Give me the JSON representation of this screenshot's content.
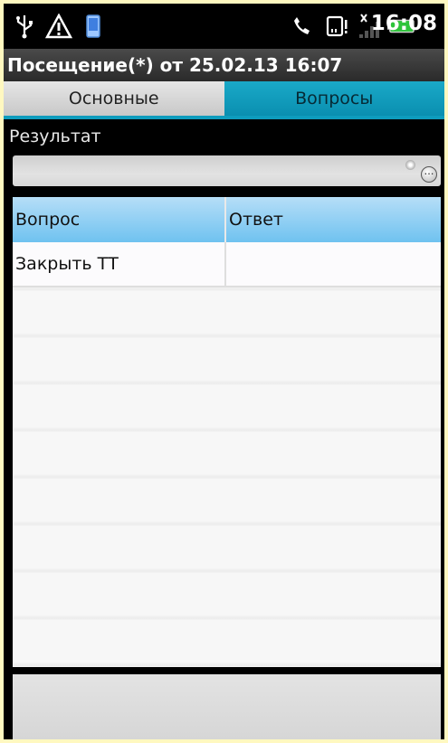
{
  "status_bar": {
    "icons": [
      "usb-icon",
      "warning-icon",
      "sim-icon",
      "phone-icon",
      "sd-card-icon",
      "signal-icon",
      "battery-icon"
    ],
    "time": "16:08"
  },
  "title": "Посещение(*) от 25.02.13 16:07",
  "tabs": [
    {
      "label": "Основные",
      "active": false
    },
    {
      "label": "Вопросы",
      "active": true
    }
  ],
  "result": {
    "label": "Результат",
    "value": ""
  },
  "table": {
    "headers": [
      "Вопрос",
      "Ответ"
    ],
    "rows": [
      [
        "Закрыть ТТ",
        ""
      ]
    ]
  },
  "colors": {
    "page_background": "#fff8c0",
    "active_tab": "#0e9cbd",
    "header": "#6fc2f0"
  }
}
